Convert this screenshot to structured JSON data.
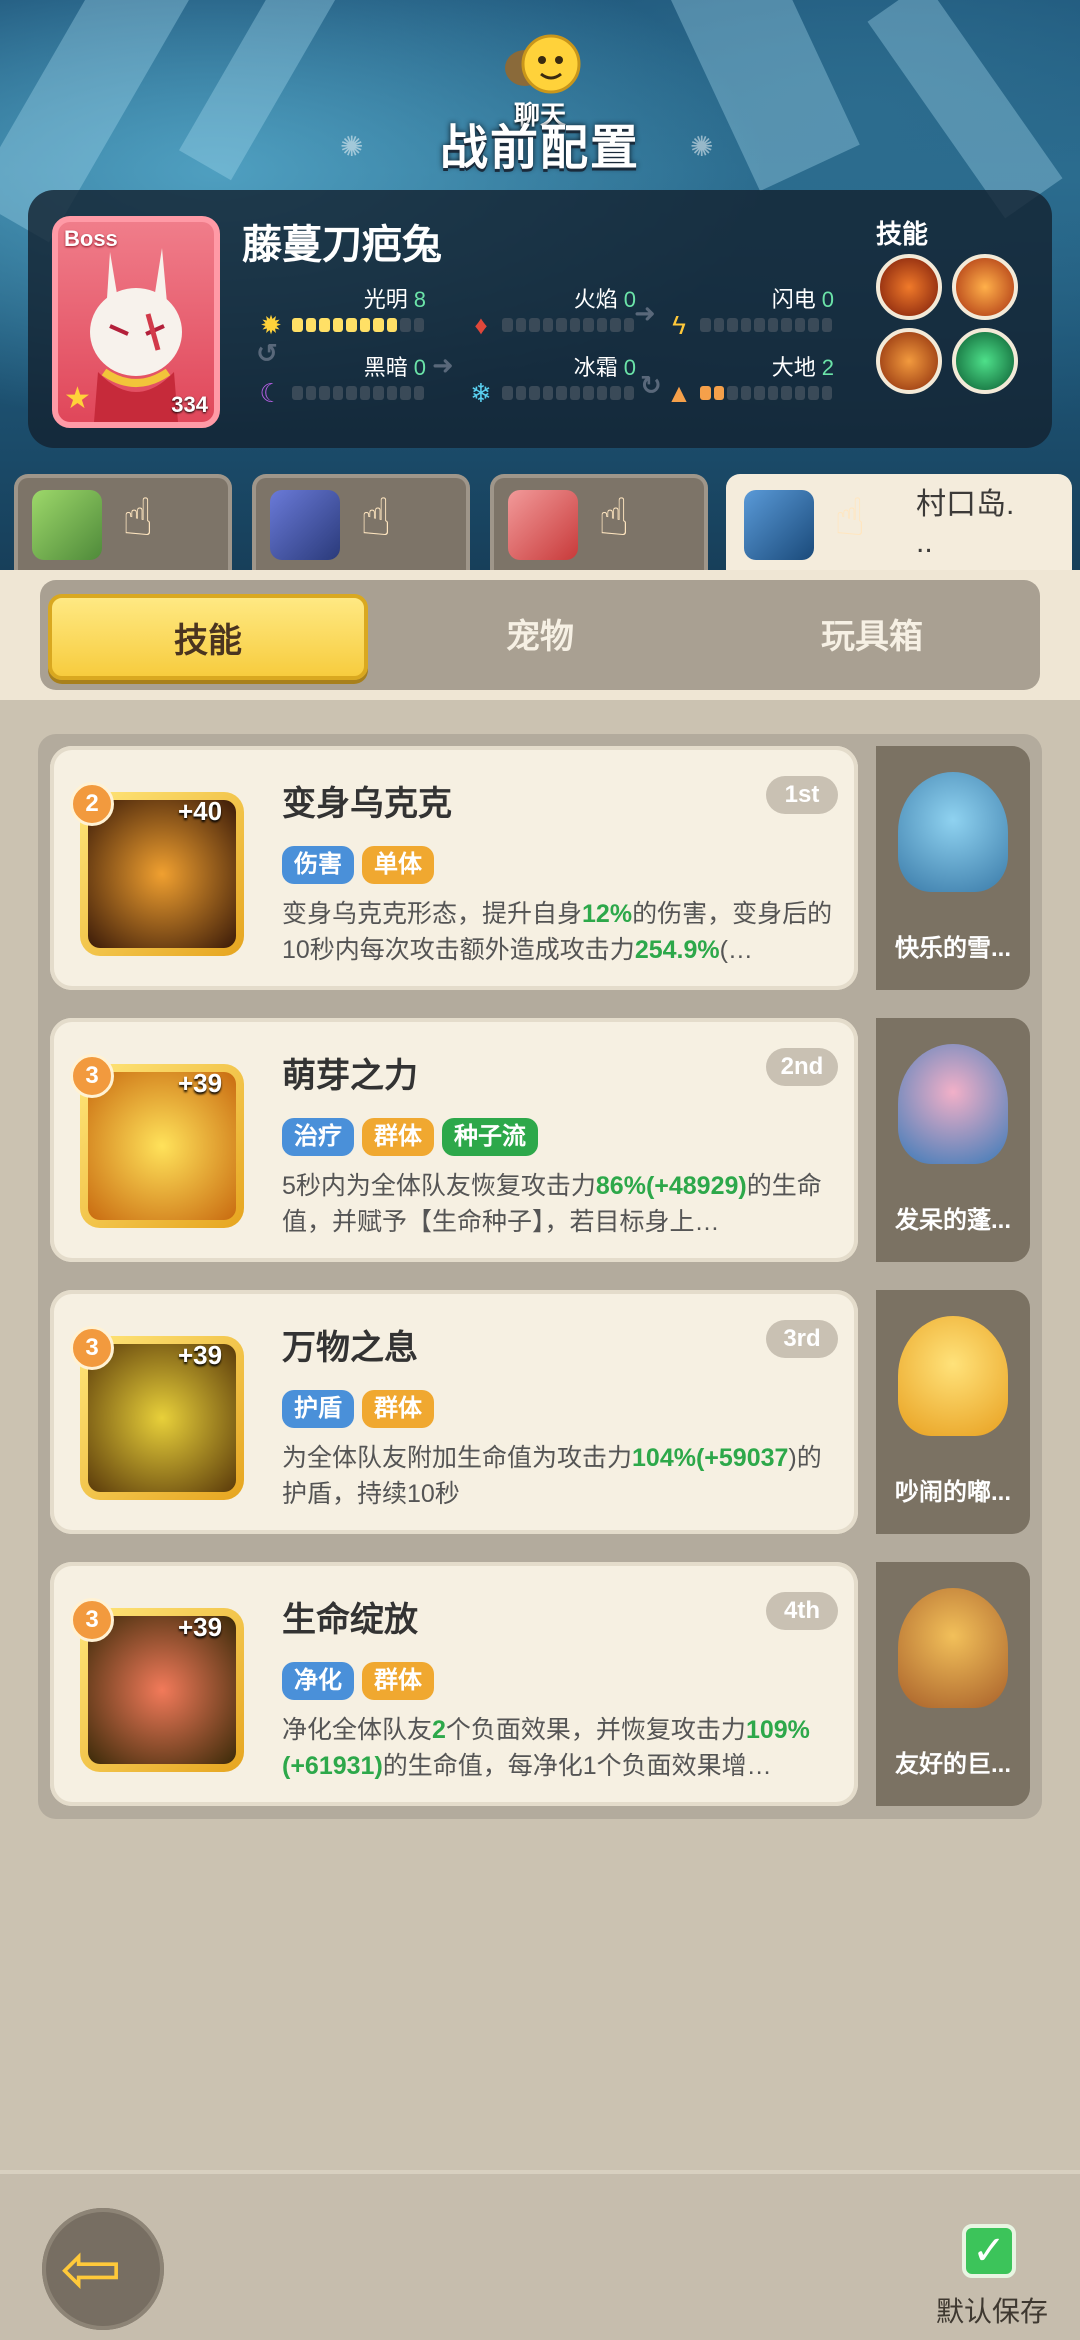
{
  "header": {
    "chat_label": "聊天",
    "title": "战前配置"
  },
  "boss": {
    "tag": "Boss",
    "name": "藤蔓刀疤兔",
    "level": "334",
    "elements": [
      {
        "label": "光明",
        "value": "8",
        "filled": 8,
        "icon": "sun-icon",
        "color": "#ffe066"
      },
      {
        "label": "火焰",
        "value": "0",
        "filled": 0,
        "icon": "fire-icon",
        "color": "#e0473a"
      },
      {
        "label": "闪电",
        "value": "0",
        "filled": 0,
        "icon": "lightning-icon",
        "color": "#ffc93a"
      },
      {
        "label": "黑暗",
        "value": "0",
        "filled": 0,
        "icon": "moon-icon",
        "color": "#b25ee0"
      },
      {
        "label": "冰霜",
        "value": "0",
        "filled": 0,
        "icon": "snowflake-icon",
        "color": "#5ad0f0"
      },
      {
        "label": "大地",
        "value": "2",
        "filled": 2,
        "icon": "earth-icon",
        "color": "#f5a04a"
      }
    ],
    "skills_label": "技能"
  },
  "char_tabs": [
    {
      "name": "character-1",
      "text": ""
    },
    {
      "name": "character-2",
      "text": ""
    },
    {
      "name": "character-3",
      "text": ""
    },
    {
      "name": "character-4",
      "text": "村口岛.\n.."
    }
  ],
  "segments": [
    "技能",
    "宠物",
    "玩具箱"
  ],
  "skills": [
    {
      "level": "2",
      "plus": "+40",
      "title": "变身乌克克",
      "rank": "1st",
      "tags": [
        {
          "text": "伤害",
          "color": "blue"
        },
        {
          "text": "单体",
          "color": "orange"
        }
      ],
      "desc_parts": [
        "变身乌克克形态，提升自身",
        "12%",
        "的伤害，变身后的10秒内每次攻击额外造成攻击力",
        "254.9%",
        "(…"
      ],
      "pet_name": "快乐的雪..."
    },
    {
      "level": "3",
      "plus": "+39",
      "title": "萌芽之力",
      "rank": "2nd",
      "tags": [
        {
          "text": "治疗",
          "color": "blue"
        },
        {
          "text": "群体",
          "color": "orange"
        },
        {
          "text": "种子流",
          "color": "green"
        }
      ],
      "desc_parts": [
        "5秒内为全体队友恢复攻击力",
        "86%(+48929)",
        "的生命值，并赋予【生命种子】，若目标身上…",
        "",
        ""
      ],
      "pet_name": "发呆的蓬..."
    },
    {
      "level": "3",
      "plus": "+39",
      "title": "万物之息",
      "rank": "3rd",
      "tags": [
        {
          "text": "护盾",
          "color": "blue"
        },
        {
          "text": "群体",
          "color": "orange"
        }
      ],
      "desc_parts": [
        "为全体队友附加生命值为攻击力",
        "104%(+59037",
        ")的护盾，持续10秒",
        "",
        ""
      ],
      "pet_name": "吵闹的嘟..."
    },
    {
      "level": "3",
      "plus": "+39",
      "title": "生命绽放",
      "rank": "4th",
      "tags": [
        {
          "text": "净化",
          "color": "blue"
        },
        {
          "text": "群体",
          "color": "orange"
        }
      ],
      "desc_parts": [
        "净化全体队友",
        "2",
        "个负面效果，并恢复攻击力",
        "109%(+61931)",
        "的生命值，每净化1个负面效果增…"
      ],
      "pet_name": "友好的巨..."
    }
  ],
  "bottom": {
    "save_label": "默认保存"
  }
}
